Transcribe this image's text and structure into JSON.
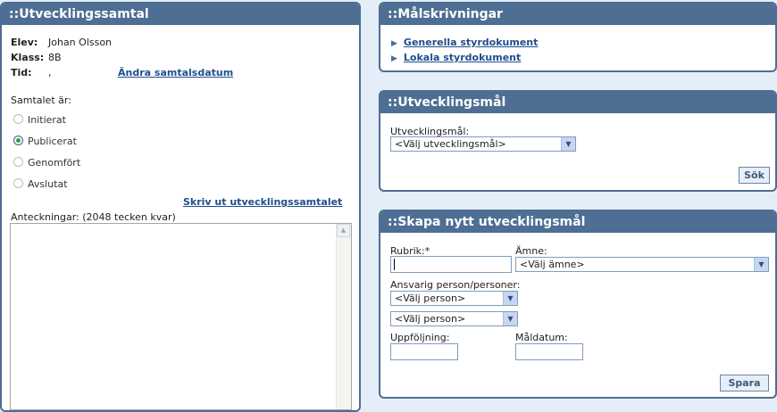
{
  "utvecklingssamtal": {
    "title": "::Utvecklingssamtal",
    "elev_label": "Elev:",
    "elev_value": "Johan Olsson",
    "klass_label": "Klass:",
    "klass_value": "8B",
    "tid_label": "Tid:",
    "tid_value": ",",
    "change_date_link": "Ändra samtalsdatum",
    "status_label": "Samtalet är:",
    "status_options": [
      {
        "label": "Initierat",
        "selected": false
      },
      {
        "label": "Publicerat",
        "selected": true
      },
      {
        "label": "Genomfört",
        "selected": false
      },
      {
        "label": "Avslutat",
        "selected": false
      }
    ],
    "print_link": "Skriv ut utvecklingssamtalet",
    "notes_label": "Anteckningar: (2048 tecken kvar)",
    "notes_value": ""
  },
  "malskrivningar": {
    "title": "::Målskrivningar",
    "links": [
      "Generella styrdokument",
      "Lokala styrdokument"
    ]
  },
  "utvecklingsmal": {
    "title": "::Utvecklingsmål",
    "field_label": "Utvecklingsmål:",
    "select_value": "<Välj utvecklingsmål>",
    "search_button": "Sök"
  },
  "skapa": {
    "title": "::Skapa nytt utvecklingsmål",
    "rubrik_label": "Rubrik:*",
    "rubrik_value": "",
    "amne_label": "Ämne:",
    "amne_value": "<Välj ämne>",
    "ansvarig_label": "Ansvarig person/personer:",
    "person1_value": "<Välj person>",
    "person2_value": "<Välj person>",
    "uppfoljning_label": "Uppföljning:",
    "maldatum_label": "Måldatum:",
    "save_button": "Spara"
  }
}
